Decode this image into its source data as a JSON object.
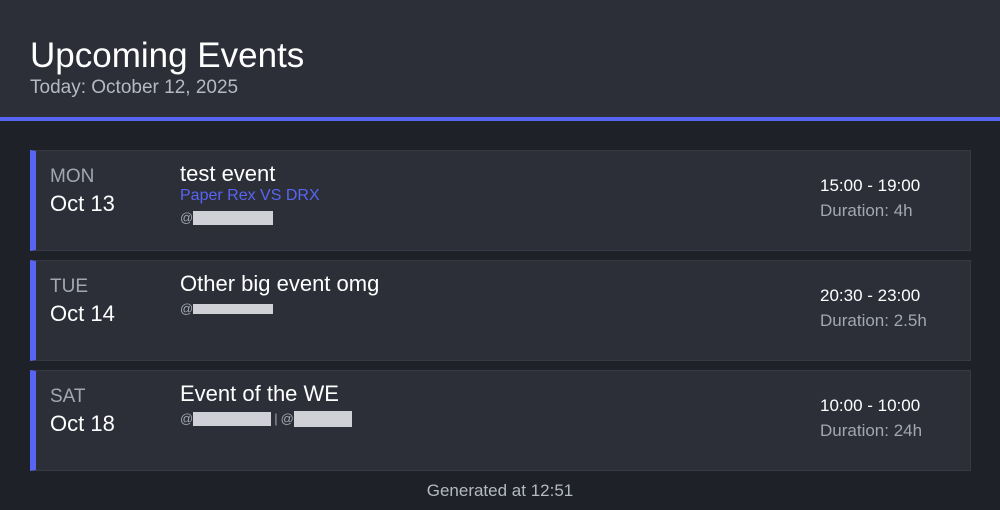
{
  "header": {
    "title": "Upcoming Events",
    "subtitle": "Today: October 12, 2025"
  },
  "events": [
    {
      "day_of_week": "MON",
      "date": "Oct 13",
      "title": "test event",
      "subtitle": "Paper Rex VS DRX",
      "mention_prefix": "@",
      "time": "15:00 - 19:00",
      "duration": "Duration: 4h"
    },
    {
      "day_of_week": "TUE",
      "date": "Oct 14",
      "title": "Other big event omg",
      "mention_prefix": "@",
      "time": "20:30 - 23:00",
      "duration": "Duration: 2.5h"
    },
    {
      "day_of_week": "SAT",
      "date": "Oct 18",
      "title": "Event of the WE",
      "mention_prefix": "@",
      "mention_prefix_2": "@",
      "separator": "|",
      "time": "10:00 - 10:00",
      "duration": "Duration: 24h"
    }
  ],
  "footer": {
    "text": "Generated at 12:51"
  },
  "colors": {
    "accent": "#5865f2",
    "background": "#1f2128",
    "card": "#2c2f38",
    "muted_text": "#a3a7b0"
  }
}
